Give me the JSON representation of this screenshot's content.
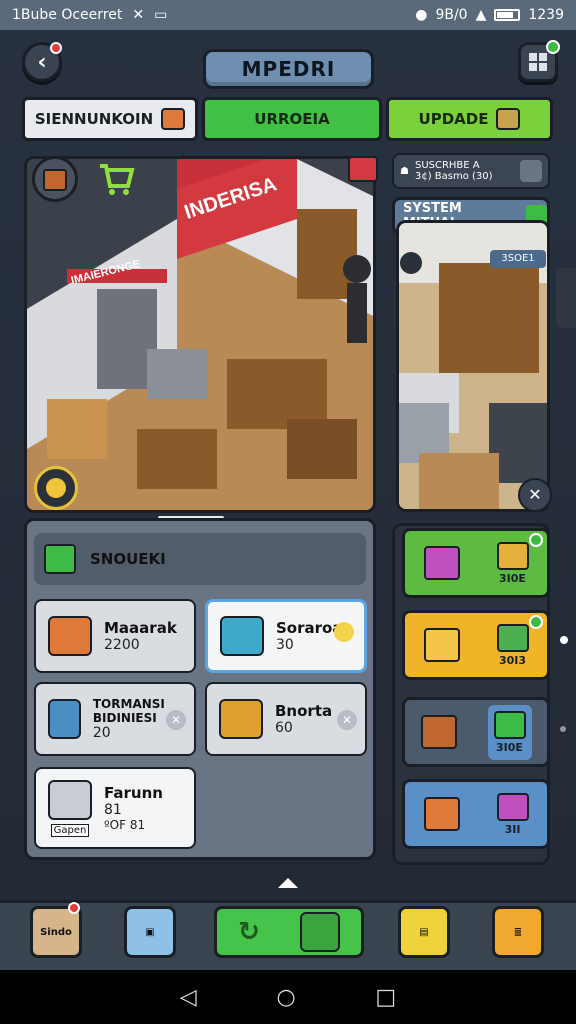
{
  "status_bar": {
    "left_text": "1Bube Oceerret",
    "time": "1239",
    "signal_text": "9B/0"
  },
  "header": {
    "title": "MPEDRI",
    "back_icon": "back-arrow-icon",
    "menu_icon": "grid-menu-icon"
  },
  "tabs": [
    {
      "label": "SIENNUNKOIN",
      "color": "#e8eaee"
    },
    {
      "label": "URROEIA",
      "color": "#42c044"
    },
    {
      "label": "UPDADE",
      "color": "#7bd13c"
    }
  ],
  "scene": {
    "sign_main": "INDERISA",
    "sign_wall": "IMAIERONGE",
    "side_label": "3SOE1"
  },
  "side_info": {
    "line1": "SUSCRHBE A",
    "line2": "3¢) Basmo (30)",
    "system_button": "SYSTEM MITUAL"
  },
  "panel": {
    "header_label": "SNOUEKI",
    "cards": [
      {
        "title": "Maaarak",
        "value": "2200"
      },
      {
        "title": "Soraroa",
        "value": "30"
      },
      {
        "title": "TORMANSI BIDINIESI",
        "value": "20"
      },
      {
        "title": "Bnorta",
        "value": "60"
      },
      {
        "title": "Farunn",
        "value": "81",
        "extra": "ºOF 81",
        "badge": "Gapen"
      }
    ]
  },
  "right_cards": [
    {
      "label": "3I0E",
      "color": "#5dbb42"
    },
    {
      "label": "30I3",
      "color": "#f0b429"
    },
    {
      "label": "3I0E",
      "color": "#5a8fc8"
    },
    {
      "label": "3II",
      "color": "#5a8fc8"
    }
  ],
  "bottom_nav": [
    {
      "label": "Sindo",
      "icon": "crate-icon"
    },
    {
      "label": "",
      "icon": "shop-bag-icon"
    },
    {
      "label": "",
      "icon": "refresh-icon"
    },
    {
      "label": "",
      "icon": "package-icon"
    },
    {
      "label": "",
      "icon": "shopping-bag-icon"
    },
    {
      "label": "",
      "icon": "list-icon"
    }
  ],
  "colors": {
    "accent_green": "#42c044",
    "accent_yellow": "#f0b429",
    "accent_blue": "#5a8fc8"
  }
}
